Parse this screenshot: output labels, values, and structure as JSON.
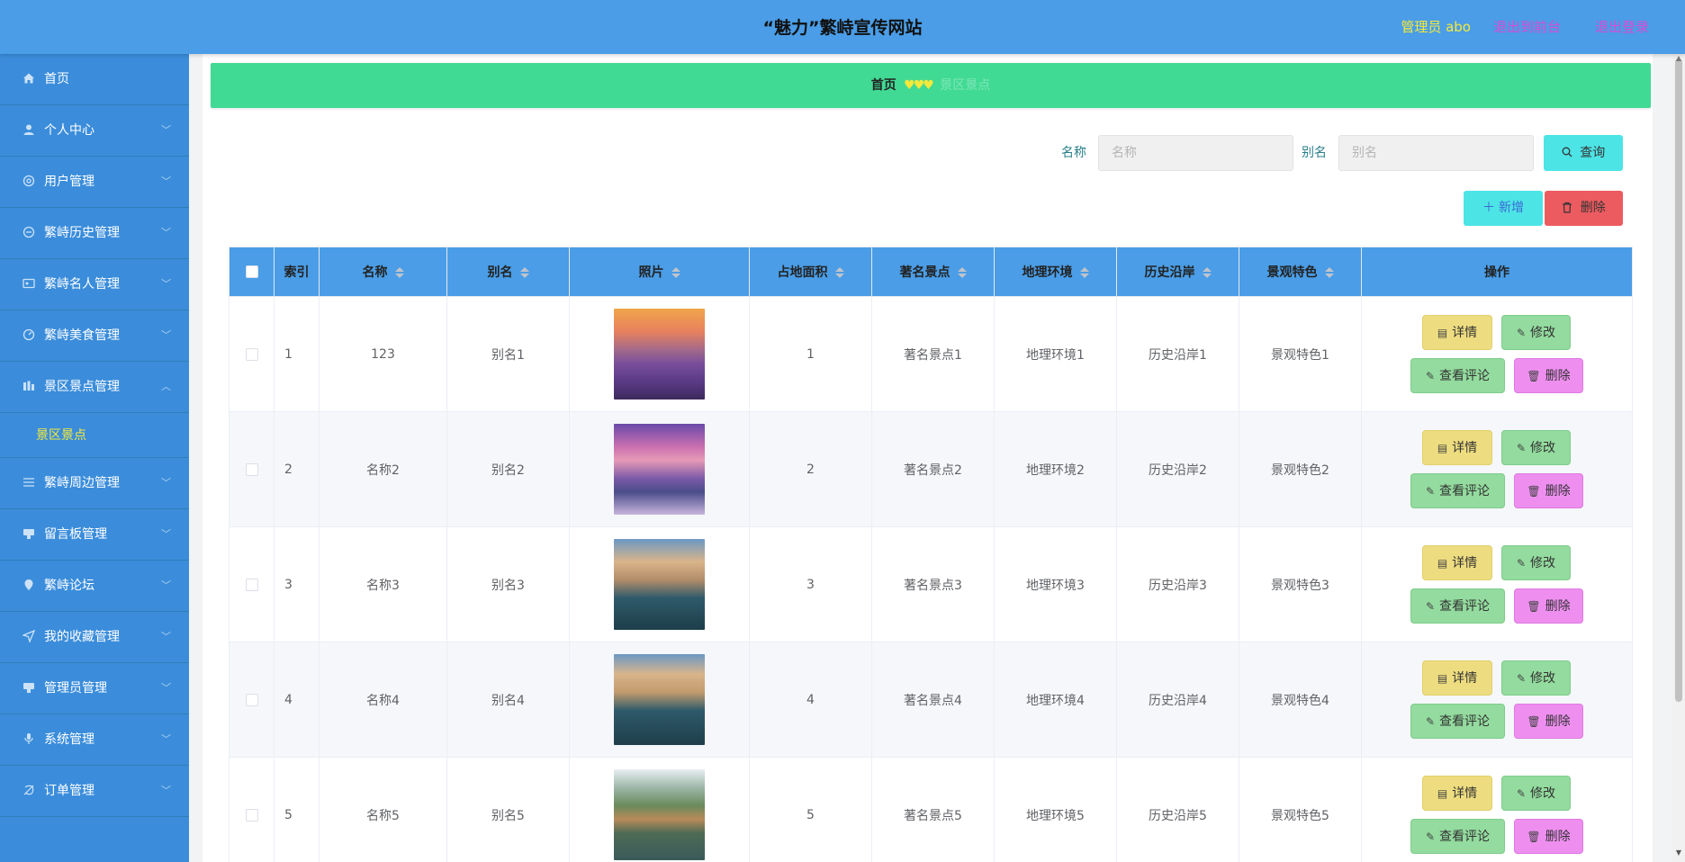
{
  "header": {
    "title": "“魅力”繁峙宣传网站",
    "admin": "管理员 abo",
    "back_front": "退出到前台",
    "logout": "退出登录"
  },
  "sidebar": {
    "items": [
      {
        "label": "首页",
        "icon": "home-icon"
      },
      {
        "label": "个人中心",
        "icon": "user-icon"
      },
      {
        "label": "用户管理",
        "icon": "users-icon"
      },
      {
        "label": "繁峙历史管理",
        "icon": "history-icon"
      },
      {
        "label": "繁峙名人管理",
        "icon": "id-card-icon"
      },
      {
        "label": "繁峙美食管理",
        "icon": "food-icon"
      },
      {
        "label": "景区景点管理",
        "icon": "scenic-icon"
      },
      {
        "label": "繁峙周边管理",
        "icon": "list-icon"
      },
      {
        "label": "留言板管理",
        "icon": "message-icon"
      },
      {
        "label": "繁峙论坛",
        "icon": "forum-icon"
      },
      {
        "label": "我的收藏管理",
        "icon": "favorite-icon"
      },
      {
        "label": "管理员管理",
        "icon": "admin-icon"
      },
      {
        "label": "系统管理",
        "icon": "system-icon"
      },
      {
        "label": "订单管理",
        "icon": "order-icon"
      }
    ],
    "submenu": "景区景点"
  },
  "breadcrumb": {
    "home": "首页",
    "separator": "♥♥♥",
    "current": "景区景点"
  },
  "search": {
    "name_label": "名称",
    "name_placeholder": "名称",
    "alias_label": "别名",
    "alias_placeholder": "别名",
    "query_label": "查询"
  },
  "actions": {
    "add_label": "新增",
    "delete_label": "删除"
  },
  "table": {
    "headers": [
      "索引",
      "名称",
      "别名",
      "照片",
      "占地面积",
      "著名景点",
      "地理环境",
      "历史沿岸",
      "景观特色",
      "操作"
    ],
    "rows": [
      {
        "index": "1",
        "name": "123",
        "alias": "别名1",
        "area": "1",
        "spot": "著名景点1",
        "geo": "地理环境1",
        "history": "历史沿岸1",
        "feature": "景观特色1"
      },
      {
        "index": "2",
        "name": "名称2",
        "alias": "别名2",
        "area": "2",
        "spot": "著名景点2",
        "geo": "地理环境2",
        "history": "历史沿岸2",
        "feature": "景观特色2"
      },
      {
        "index": "3",
        "name": "名称3",
        "alias": "别名3",
        "area": "3",
        "spot": "著名景点3",
        "geo": "地理环境3",
        "history": "历史沿岸3",
        "feature": "景观特色3"
      },
      {
        "index": "4",
        "name": "名称4",
        "alias": "别名4",
        "area": "4",
        "spot": "著名景点4",
        "geo": "地理环境4",
        "history": "历史沿岸4",
        "feature": "景观特色4"
      },
      {
        "index": "5",
        "name": "名称5",
        "alias": "别名5",
        "area": "5",
        "spot": "著名景点5",
        "geo": "地理环境5",
        "history": "历史沿岸5",
        "feature": "景观特色5"
      }
    ],
    "row_actions": {
      "detail": "详情",
      "edit": "修改",
      "comment": "查看评论",
      "remove": "删除"
    }
  },
  "colors": {
    "header_bg": "#4a9de6",
    "sidebar_bg": "#3b8ddb",
    "breadcrumb_bg": "#41da94",
    "accent_yellow": "#f6e93a",
    "link_magenta": "#d94bd5"
  }
}
